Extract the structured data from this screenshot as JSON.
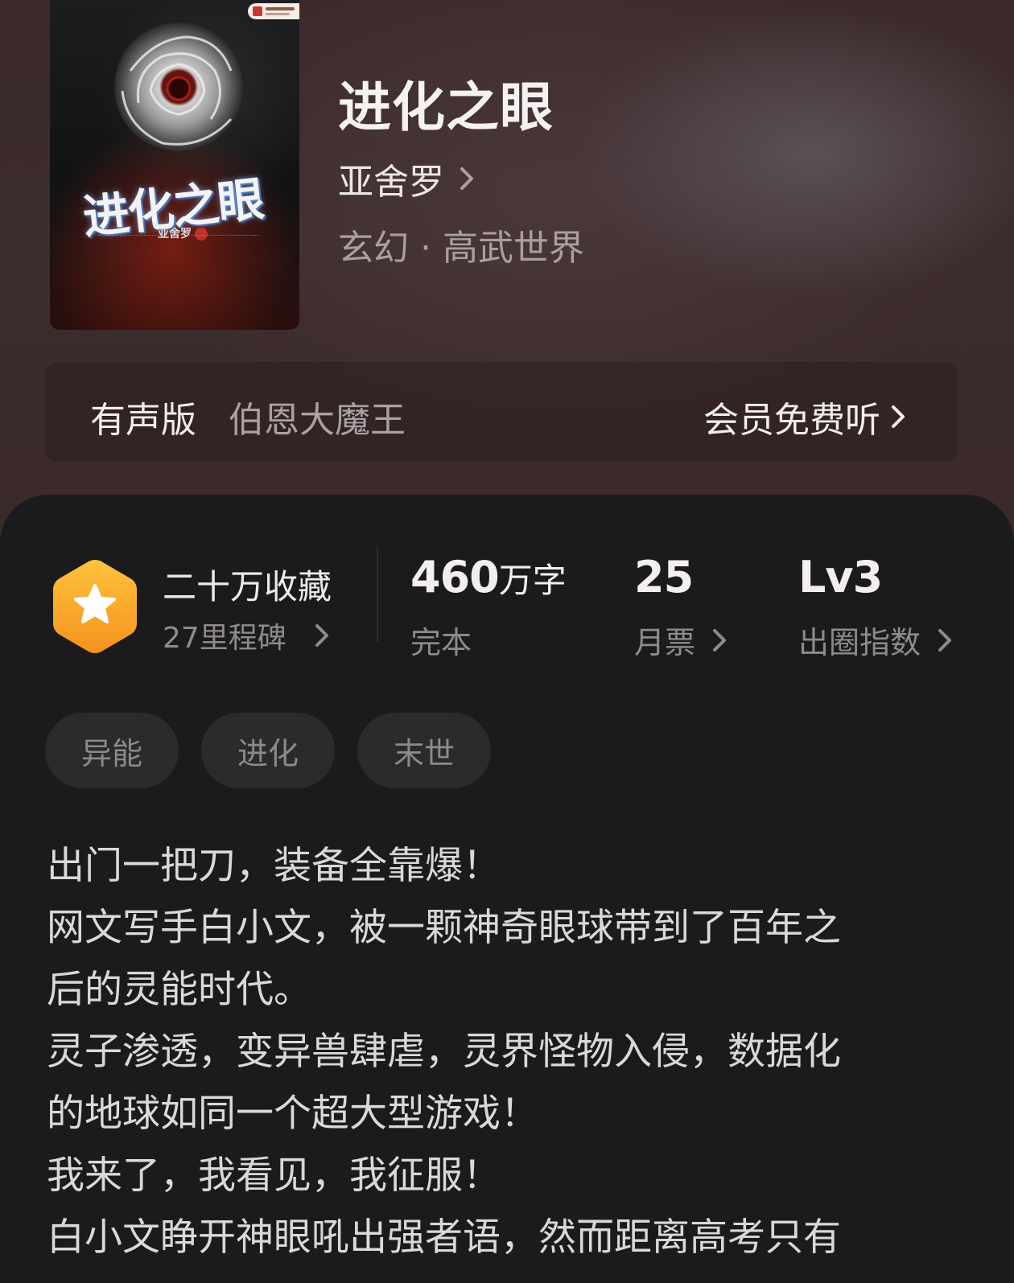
{
  "book": {
    "title": "进化之眼",
    "author": "亚舍罗",
    "genre": "玄幻 · 高武世界",
    "cover": {
      "title": "进化之眼",
      "author": "亚舍罗"
    }
  },
  "audio": {
    "label": "有声版",
    "narrator": "伯恩大魔王",
    "cta": "会员免费听"
  },
  "stats": {
    "favorites": "二十万收藏",
    "milestone": "27里程碑",
    "words_value": "460",
    "words_unit": "万字",
    "words_label": "完本",
    "tickets_value": "25",
    "tickets_label": "月票",
    "circle_value": "Lv3",
    "circle_label": "出圈指数"
  },
  "tags": [
    "异能",
    "进化",
    "末世"
  ],
  "synopsis": [
    "出门一把刀，装备全靠爆！",
    "网文写手白小文，被一颗神奇眼球带到了百年之",
    "后的灵能时代。",
    "灵子渗透，变异兽肆虐，灵界怪物入侵，数据化",
    "的地球如同一个超大型游戏！",
    "我来了，我看见，我征服！",
    "白小文睁开神眼吼出强者语，然而距离高考只有"
  ],
  "icons": {
    "author_chevron": "chevron-right-icon",
    "badge": "star-hexagon-icon"
  },
  "colors": {
    "hero_bg": "#3c2a2b",
    "panel_bg": "#1b1b1d",
    "badge_orange": "#f7a22a",
    "tag_bg": "#2b2a2c"
  }
}
